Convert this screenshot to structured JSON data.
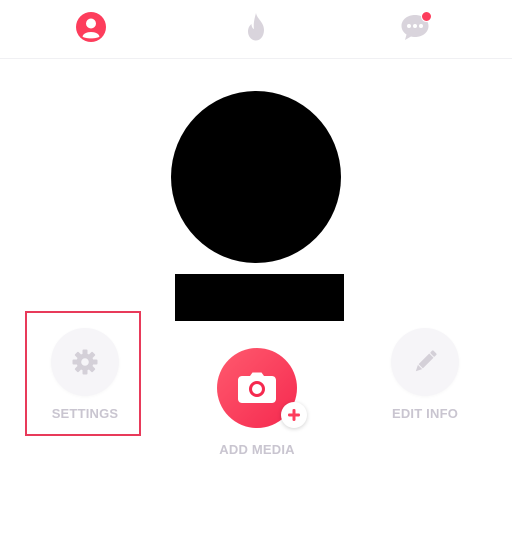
{
  "nav": {
    "items": [
      {
        "name": "profile",
        "icon": "profile-icon",
        "active": true,
        "color": "#fd3d5c"
      },
      {
        "name": "discover",
        "icon": "flame-icon",
        "active": false,
        "color": "#d9d4dc"
      },
      {
        "name": "messages",
        "icon": "chat-bubbles-icon",
        "active": false,
        "color": "#d9d4dc",
        "has_notification": true
      }
    ]
  },
  "profile": {
    "photo": "redacted",
    "name": "redacted"
  },
  "actions": {
    "settings_label": "SETTINGS",
    "add_media_label": "ADD MEDIA",
    "edit_info_label": "EDIT INFO"
  },
  "colors": {
    "accent": "#fd3d5c",
    "highlight_border": "#e83a5a",
    "muted_icon": "#d4d0d8",
    "muted_label": "#c9c5d0"
  }
}
